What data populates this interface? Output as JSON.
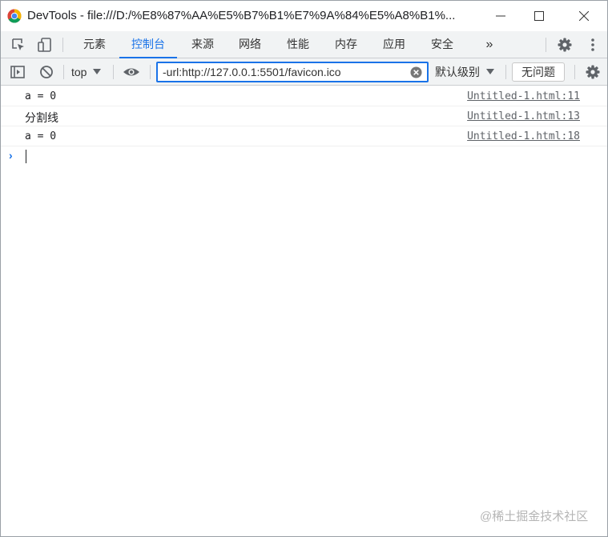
{
  "window": {
    "title": "DevTools - file:///D:/%E8%87%AA%E5%B7%B1%E7%9A%84%E5%A8%B1%..."
  },
  "tabs": [
    {
      "label": "元素",
      "active": false
    },
    {
      "label": "控制台",
      "active": true
    },
    {
      "label": "来源",
      "active": false
    },
    {
      "label": "网络",
      "active": false
    },
    {
      "label": "性能",
      "active": false
    },
    {
      "label": "内存",
      "active": false
    },
    {
      "label": "应用",
      "active": false
    },
    {
      "label": "安全",
      "active": false
    }
  ],
  "tabbar": {
    "more_label": "»"
  },
  "toolbar": {
    "context_value": "top",
    "filter_value": "-url:http://127.0.0.1:5501/favicon.ico",
    "level_label": "默认级别",
    "issues_label": "无问题"
  },
  "console": {
    "messages": [
      {
        "text": "a = 0",
        "source": "Untitled-1.html:11"
      },
      {
        "text": "分割线",
        "source": "Untitled-1.html:13"
      },
      {
        "text": "a = 0",
        "source": "Untitled-1.html:18"
      }
    ],
    "prompt_symbol": "›"
  },
  "watermark": "@稀土掘金技术社区",
  "colors": {
    "accent": "#1a73e8",
    "toolbar_bg": "#f1f3f4",
    "link": "#5f6368"
  }
}
